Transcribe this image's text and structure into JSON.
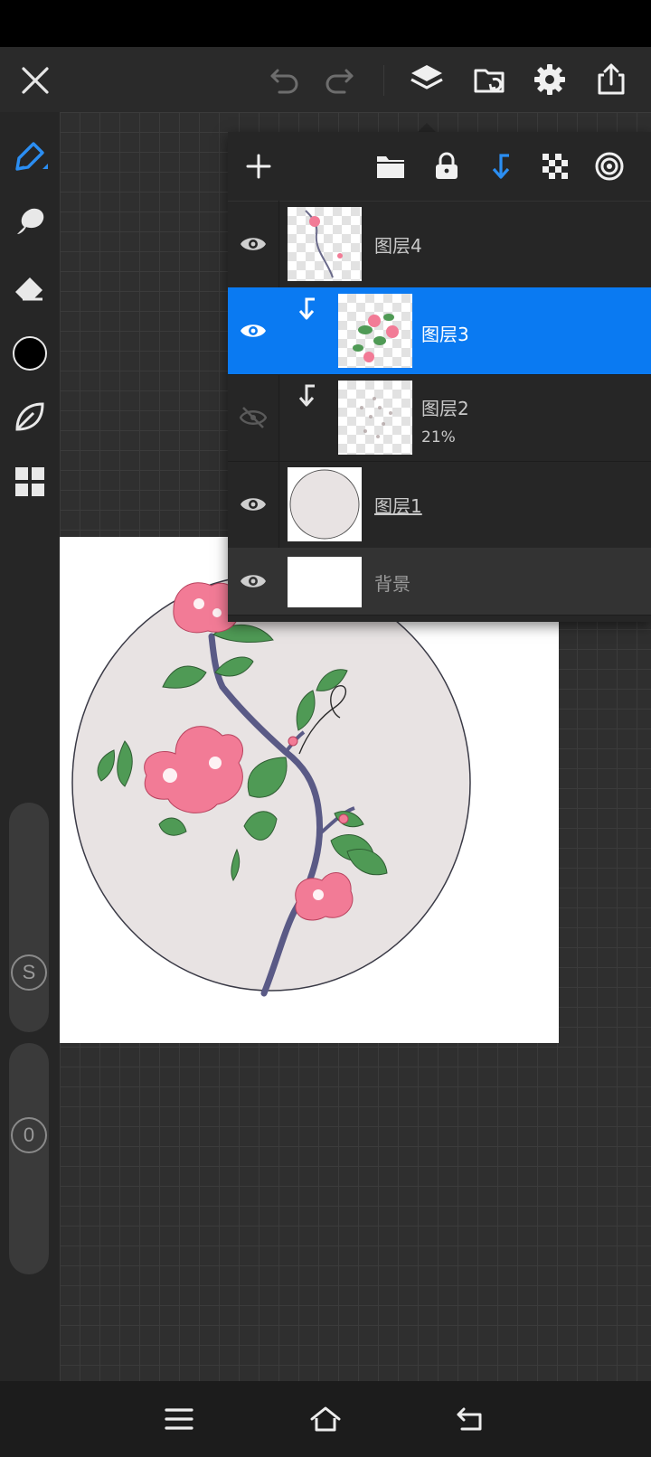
{
  "toolbar": {
    "close": "close-icon",
    "undo": "undo-icon",
    "redo": "redo-icon",
    "layers": "layers-icon",
    "import": "import-icon",
    "settings": "gear-icon",
    "export": "share-icon"
  },
  "tools": [
    "pen-tool-icon",
    "smudge-icon",
    "eraser-icon",
    "color-swatch",
    "leaf-brush-icon",
    "grid-menu-icon"
  ],
  "sliders": {
    "size_label": "S",
    "opacity_label": "0"
  },
  "colors": {
    "accent": "#0a7af2",
    "current_color": "#000000"
  },
  "layers_panel": {
    "actions": [
      "add-layer-icon",
      "folder-icon",
      "lock-icon",
      "clip-icon",
      "checker-icon",
      "target-icon"
    ],
    "layers": [
      {
        "name": "图层4",
        "visible": true,
        "selected": false,
        "clipped": false,
        "opacity": ""
      },
      {
        "name": "图层3",
        "visible": true,
        "selected": true,
        "clipped": true,
        "opacity": ""
      },
      {
        "name": "图层2",
        "visible": false,
        "selected": false,
        "clipped": true,
        "opacity": "21%"
      },
      {
        "name": "图层1",
        "visible": true,
        "selected": false,
        "clipped": false,
        "opacity": ""
      },
      {
        "name": "背景",
        "visible": true,
        "selected": false,
        "clipped": false,
        "opacity": ""
      }
    ]
  },
  "nav": {
    "menu": "menu-icon",
    "home": "home-icon",
    "back": "back-icon"
  }
}
